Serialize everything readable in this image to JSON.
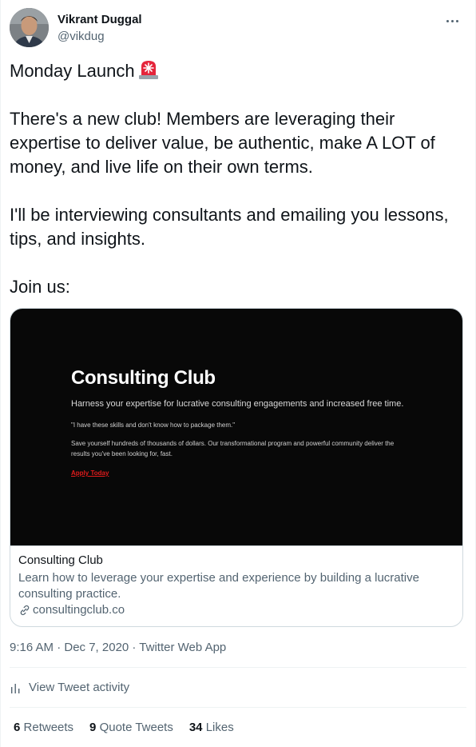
{
  "author": {
    "name": "Vikrant Duggal",
    "handle": "@vikdug"
  },
  "tweet": {
    "line1": "Monday Launch",
    "line1_emoji": "rotating-light-icon",
    "para2": "There's a new club! Members are leveraging their expertise to deliver value, be authentic, make A LOT of money, and live life on their own terms.",
    "para3": "I'll be interviewing consultants and emailing you lessons, tips, and insights.",
    "para4": "Join us:"
  },
  "card": {
    "image": {
      "title": "Consulting Club",
      "subtitle": "Harness your expertise for lucrative consulting engagements and increased free time.",
      "quote": "\"I have these skills and don't know how to package them.\"",
      "body": "Save yourself hundreds of thousands of dollars. Our transformational program and powerful community deliver the results you've been looking for, fast.",
      "cta": "Apply Today"
    },
    "title": "Consulting Club",
    "description": "Learn how to leverage your expertise and experience by building a lucrative consulting practice.",
    "domain": "consultingclub.co"
  },
  "meta": {
    "timestamp": "9:16 AM · Dec 7, 2020 · Twitter Web App"
  },
  "activity": {
    "label": "View Tweet activity"
  },
  "stats": {
    "retweets_count": "6",
    "retweets_label": "Retweets",
    "quotes_count": "9",
    "quotes_label": "Quote Tweets",
    "likes_count": "34",
    "likes_label": "Likes"
  },
  "colors": {
    "text_primary": "#0f1419",
    "text_secondary": "#536471",
    "border": "#cfd9de",
    "cta_red": "#e01b1b"
  }
}
